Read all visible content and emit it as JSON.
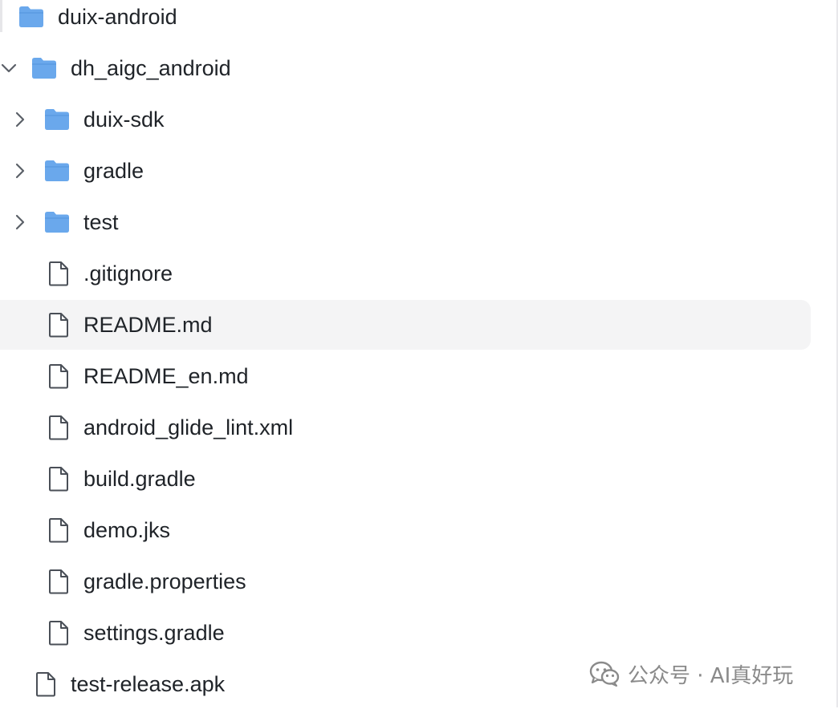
{
  "tree": {
    "items": [
      {
        "label": "duix-android",
        "type": "folder",
        "depth": 0,
        "expanded": null
      },
      {
        "label": "dh_aigc_android",
        "type": "folder",
        "depth": 1,
        "expanded": true
      },
      {
        "label": "duix-sdk",
        "type": "folder",
        "depth": 2,
        "expanded": false
      },
      {
        "label": "gradle",
        "type": "folder",
        "depth": 2,
        "expanded": false
      },
      {
        "label": "test",
        "type": "folder",
        "depth": 2,
        "expanded": false
      },
      {
        "label": ".gitignore",
        "type": "file",
        "depth": 2
      },
      {
        "label": "README.md",
        "type": "file",
        "depth": 2,
        "highlighted": true
      },
      {
        "label": "README_en.md",
        "type": "file",
        "depth": 2
      },
      {
        "label": "android_glide_lint.xml",
        "type": "file",
        "depth": 2
      },
      {
        "label": "build.gradle",
        "type": "file",
        "depth": 2
      },
      {
        "label": "demo.jks",
        "type": "file",
        "depth": 2
      },
      {
        "label": "gradle.properties",
        "type": "file",
        "depth": 2
      },
      {
        "label": "settings.gradle",
        "type": "file",
        "depth": 2
      },
      {
        "label": "test-release.apk",
        "type": "file",
        "depth": 1
      }
    ]
  },
  "watermark": {
    "text": "公众号 · AI真好玩"
  },
  "colors": {
    "folder": "#6aa8ec",
    "folder_dark": "#5a9be2",
    "file_stroke": "#4a4f57",
    "chevron": "#5b6068",
    "highlight": "#f4f4f5"
  }
}
